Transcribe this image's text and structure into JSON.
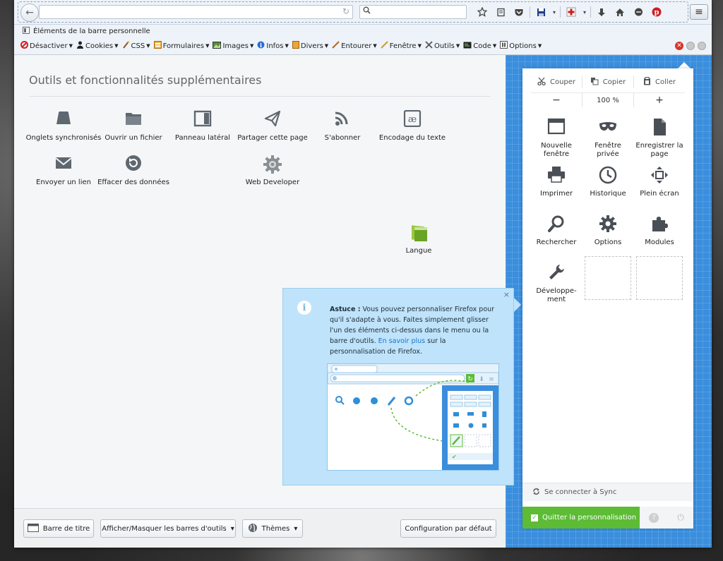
{
  "nav": {
    "url_value": "",
    "search_value": "",
    "reload_glyph": "↻",
    "back_glyph": "←",
    "menu_glyph": "≡"
  },
  "bookmarks": {
    "label": "Éléments de la barre personnelle"
  },
  "webdev_toolbar": {
    "items": [
      {
        "label": "Désactiver",
        "icon": "disable-icon"
      },
      {
        "label": "Cookies",
        "icon": "cookies-icon"
      },
      {
        "label": "CSS",
        "icon": "css-icon"
      },
      {
        "label": "Formulaires",
        "icon": "forms-icon"
      },
      {
        "label": "Images",
        "icon": "images-icon"
      },
      {
        "label": "Infos",
        "icon": "info-icon"
      },
      {
        "label": "Divers",
        "icon": "misc-icon"
      },
      {
        "label": "Entourer",
        "icon": "outline-icon"
      },
      {
        "label": "Fenêtre",
        "icon": "resize-icon"
      },
      {
        "label": "Outils",
        "icon": "tools-icon"
      },
      {
        "label": "Code",
        "icon": "code-icon"
      },
      {
        "label": "Options",
        "icon": "options-icon"
      }
    ]
  },
  "content": {
    "title": "Outils et fonctionnalités supplémentaires",
    "tools": [
      {
        "label": "Onglets synchronisés",
        "icon": "synced-tabs-icon"
      },
      {
        "label": "Ouvrir un fichier",
        "icon": "folder-icon"
      },
      {
        "label": "Panneau latéral",
        "icon": "sidebar-icon"
      },
      {
        "label": "Partager cette page",
        "icon": "share-icon"
      },
      {
        "label": "S'abonner",
        "icon": "rss-icon"
      },
      {
        "label": "Encodage du texte",
        "icon": "encoding-icon"
      },
      {
        "label": "Envoyer un lien",
        "icon": "email-icon"
      },
      {
        "label": "Effacer des données",
        "icon": "forget-icon"
      },
      {
        "label": "Web Developer",
        "icon": "webdev-gear-icon"
      },
      {
        "label": "Langue",
        "icon": "language-icon"
      }
    ]
  },
  "tip": {
    "heading": "Astuce :",
    "body": " Vous pouvez personnaliser Firefox pour qu'il s'adapte à vous. Faites simplement glisser l'un des éléments ci-dessus dans le menu ou la barre d'outils.",
    "link": "En savoir plus",
    "link_tail": " sur la personnalisation de Firefox.",
    "close": "×",
    "info_glyph": "i"
  },
  "bottom": {
    "titlebar_label": "Barre de titre",
    "toolbars_label": "Afficher/Masquer les barres d'outils",
    "themes_label": "Thèmes",
    "reset_label": "Configuration par défaut",
    "dropdown_glyph": "▾"
  },
  "panel": {
    "cut": "Couper",
    "copy": "Copier",
    "paste": "Coller",
    "zoom_minus": "−",
    "zoom_level": "100 %",
    "zoom_plus": "+",
    "items": [
      {
        "label": "Nouvelle fenêtre",
        "icon": "new-window-icon"
      },
      {
        "label": "Fenêtre privée",
        "icon": "private-mask-icon"
      },
      {
        "label": "Enregistrer la page",
        "icon": "save-page-icon"
      },
      {
        "label": "Imprimer",
        "icon": "print-icon"
      },
      {
        "label": "Historique",
        "icon": "history-icon"
      },
      {
        "label": "Plein écran",
        "icon": "fullscreen-icon"
      },
      {
        "label": "Rechercher",
        "icon": "search-icon"
      },
      {
        "label": "Options",
        "icon": "gear-icon"
      },
      {
        "label": "Modules",
        "icon": "puzzle-icon"
      },
      {
        "label": "Développe-ment",
        "icon": "wrench-icon"
      }
    ],
    "sync_label": "Se connecter à Sync",
    "quit_label": "Quitter la personnalisation",
    "help_glyph": "?",
    "power_glyph": "⏻"
  },
  "colors": {
    "accent_blue": "#3a8edd",
    "tip_bg": "#bfe3fb",
    "quit_green": "#5dbb36"
  }
}
